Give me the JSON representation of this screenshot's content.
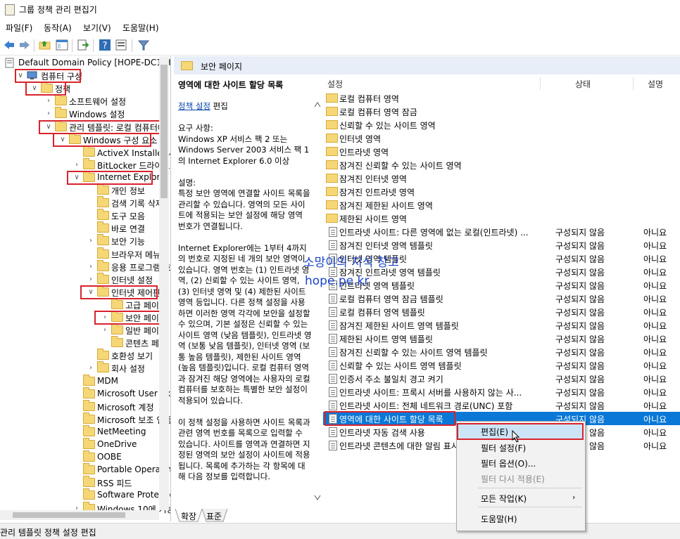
{
  "window": {
    "title": "그룹 정책 관리 편집기"
  },
  "menu": [
    "파일(F)",
    "동작(A)",
    "보기(V)",
    "도움말(H)"
  ],
  "tree": [
    {
      "label": "Default Domain Policy [HOPE-DC1.H",
      "indent": 0,
      "arrow": "",
      "icon": "policy"
    },
    {
      "label": "컴퓨터 구성",
      "indent": 1,
      "arrow": "v",
      "icon": "computer"
    },
    {
      "label": "정책",
      "indent": 2,
      "arrow": "v",
      "icon": "folder"
    },
    {
      "label": "소프트웨어 설정",
      "indent": 3,
      "arrow": ">",
      "icon": "folder"
    },
    {
      "label": "Windows 설정",
      "indent": 3,
      "arrow": ">",
      "icon": "folder"
    },
    {
      "label": "관리 템플릿: 로컬 컴퓨터에",
      "indent": 3,
      "arrow": "v",
      "icon": "folder"
    },
    {
      "label": "Windows 구성 요소",
      "indent": 4,
      "arrow": "v",
      "icon": "folder"
    },
    {
      "label": "ActiveX Installer 서비",
      "indent": 5,
      "arrow": "",
      "icon": "folder"
    },
    {
      "label": "BitLocker 드라이브",
      "indent": 5,
      "arrow": ">",
      "icon": "folder"
    },
    {
      "label": "Internet Explorer",
      "indent": 5,
      "arrow": "v",
      "icon": "folder"
    },
    {
      "label": "개인 정보",
      "indent": 6,
      "arrow": "",
      "icon": "folder"
    },
    {
      "label": "검색 기록 삭제",
      "indent": 6,
      "arrow": "",
      "icon": "folder"
    },
    {
      "label": "도구 모음",
      "indent": 6,
      "arrow": "",
      "icon": "folder"
    },
    {
      "label": "바로 연결",
      "indent": 6,
      "arrow": "",
      "icon": "folder"
    },
    {
      "label": "보안 기능",
      "indent": 6,
      "arrow": ">",
      "icon": "folder"
    },
    {
      "label": "브라우저 메뉴",
      "indent": 6,
      "arrow": "",
      "icon": "folder"
    },
    {
      "label": "응용 프로그램 호",
      "indent": 6,
      "arrow": ">",
      "icon": "folder"
    },
    {
      "label": "인터넷 설정",
      "indent": 6,
      "arrow": ">",
      "icon": "folder"
    },
    {
      "label": "인터넷 제어판",
      "indent": 6,
      "arrow": "v",
      "icon": "folder"
    },
    {
      "label": "고급 페이지",
      "indent": 7,
      "arrow": "",
      "icon": "folder"
    },
    {
      "label": "보안 페이지",
      "indent": 7,
      "arrow": ">",
      "icon": "folder"
    },
    {
      "label": "일반 페이지",
      "indent": 7,
      "arrow": ">",
      "icon": "folder"
    },
    {
      "label": "콘텐츠 페이",
      "indent": 7,
      "arrow": "",
      "icon": "folder"
    },
    {
      "label": "호환성 보기",
      "indent": 6,
      "arrow": "",
      "icon": "folder"
    },
    {
      "label": "회사 설정",
      "indent": 6,
      "arrow": ">",
      "icon": "folder"
    },
    {
      "label": "MDM",
      "indent": 5,
      "arrow": "",
      "icon": "folder"
    },
    {
      "label": "Microsoft User Expe",
      "indent": 5,
      "arrow": "",
      "icon": "folder"
    },
    {
      "label": "Microsoft 계정",
      "indent": 5,
      "arrow": "",
      "icon": "folder"
    },
    {
      "label": "Microsoft 보조 인증",
      "indent": 5,
      "arrow": "",
      "icon": "folder"
    },
    {
      "label": "NetMeeting",
      "indent": 5,
      "arrow": "",
      "icon": "folder"
    },
    {
      "label": "OneDrive",
      "indent": 5,
      "arrow": "",
      "icon": "folder"
    },
    {
      "label": "OOBE",
      "indent": 5,
      "arrow": "",
      "icon": "folder"
    },
    {
      "label": "Portable Operating",
      "indent": 5,
      "arrow": "",
      "icon": "folder"
    },
    {
      "label": "RSS 피드",
      "indent": 5,
      "arrow": "",
      "icon": "folder"
    },
    {
      "label": "Software Protection",
      "indent": 5,
      "arrow": "",
      "icon": "folder"
    },
    {
      "label": "Windows 10에 기능",
      "indent": 5,
      "arrow": ">",
      "icon": "folder"
    }
  ],
  "panel": {
    "title": "보안 페이지"
  },
  "description": {
    "title": "영역에 대한 사이트 할당 목록",
    "link": "정책 설정",
    "link_suffix": " 편집",
    "body": "요구 사항:\nWindows XP 서비스 팩 2 또는 Windows Server 2003 서비스 팩 1의 Internet Explorer 6.0 이상\n\n설명:\n특정 보안 영역에 연결할 사이트 목록을 관리할 수 있습니다. 영역의 모든 사이트에 적용되는 보안 설정에 해당 영역 번호가 연결됩니다.\n\nInternet Explorer에는 1부터 4까지의 번호로 지정된 네 개의 보안 영역이 있습니다. 영역 번호는 (1) 인트라넷 영역, (2) 신뢰할 수 있는 사이트 영역, (3) 인터넷 영역 및 (4) 제한된 사이트 영역 등입니다. 다른 정책 설정을 사용하면 이러한 영역 각각에 보안을 설정할 수 있으며, 기본 설정은 신뢰할 수 있는 사이트 영역 (낮음 템플릿), 인트라넷 영역 (보통 낮음 템플릿), 인터넷 영역 (보통 높음 템플릿), 제한된 사이트 영역 (높음 템플릿)입니다. 로컬 컴퓨터 영역과 잠겨진 해당 영역에는 사용자의 로컬 컴퓨터를 보호하는 특별한 보안 설정이 적용되어 있습니다.\n\n이 정책 설정을 사용하면 사이트 목록과 관련 영역 번호를 목록으로 입력할 수 있습니다. 사이트를 영역과 연결하면 지정된 영역의 보안 설정이 사이트에 적용됩니다. 목록에 추가하는 각 항목에 대해 다음 정보를 입력합니다."
  },
  "columns": {
    "setting": "설정",
    "state": "상태",
    "comment": "설명"
  },
  "rows": [
    {
      "name": "로컬 컴퓨터 영역",
      "state": "",
      "comment": "",
      "type": "folder"
    },
    {
      "name": "로컬 컴퓨터 영역 잠금",
      "state": "",
      "comment": "",
      "type": "folder"
    },
    {
      "name": "신뢰할 수 있는 사이트 영역",
      "state": "",
      "comment": "",
      "type": "folder"
    },
    {
      "name": "인터넷 영역",
      "state": "",
      "comment": "",
      "type": "folder"
    },
    {
      "name": "인트라넷 영역",
      "state": "",
      "comment": "",
      "type": "folder"
    },
    {
      "name": "잠겨진 신뢰할 수 있는 사이트 영역",
      "state": "",
      "comment": "",
      "type": "folder"
    },
    {
      "name": "잠겨진 인터넷 영역",
      "state": "",
      "comment": "",
      "type": "folder"
    },
    {
      "name": "잠겨진 인트라넷 영역",
      "state": "",
      "comment": "",
      "type": "folder"
    },
    {
      "name": "잠겨진 제한된 사이트 영역",
      "state": "",
      "comment": "",
      "type": "folder"
    },
    {
      "name": "제한된 사이트 영역",
      "state": "",
      "comment": "",
      "type": "folder"
    },
    {
      "name": "인트라넷 사이트: 다른 영역에 없는 로컬(인트라넷) ...",
      "state": "구성되지 않음",
      "comment": "아니요",
      "type": "policy"
    },
    {
      "name": "잠겨진 인터넷 영역 템플릿",
      "state": "구성되지 않음",
      "comment": "아니요",
      "type": "policy"
    },
    {
      "name": "인터넷 영역 템플릿",
      "state": "구성되지 않음",
      "comment": "아니요",
      "type": "policy"
    },
    {
      "name": "잠겨진 인트라넷 영역 템플릿",
      "state": "구성되지 않음",
      "comment": "아니요",
      "type": "policy"
    },
    {
      "name": "인트라넷 영역 템플릿",
      "state": "구성되지 않음",
      "comment": "아니요",
      "type": "policy"
    },
    {
      "name": "로컬 컴퓨터 영역 잠금 템플릿",
      "state": "구성되지 않음",
      "comment": "아니요",
      "type": "policy"
    },
    {
      "name": "로컬 컴퓨터 영역 템플릿",
      "state": "구성되지 않음",
      "comment": "아니요",
      "type": "policy"
    },
    {
      "name": "잠겨진 제한된 사이트 영역 템플릿",
      "state": "구성되지 않음",
      "comment": "아니요",
      "type": "policy"
    },
    {
      "name": "제한된 사이트 영역 템플릿",
      "state": "구성되지 않음",
      "comment": "아니요",
      "type": "policy"
    },
    {
      "name": "잠겨진 신뢰할 수 있는 사이트 영역 템플릿",
      "state": "구성되지 않음",
      "comment": "아니요",
      "type": "policy"
    },
    {
      "name": "신뢰할 수 있는 사이트 영역 템플릿",
      "state": "구성되지 않음",
      "comment": "아니요",
      "type": "policy"
    },
    {
      "name": "인증서 주소 불일치 경고 켜기",
      "state": "구성되지 않음",
      "comment": "아니요",
      "type": "policy"
    },
    {
      "name": "인트라넷 사이트: 프록시 서버를 사용하지 않는 사...",
      "state": "구성되지 않음",
      "comment": "아니요",
      "type": "policy"
    },
    {
      "name": "인트라넷 사이트: 전체 네트워크 경로(UNC) 포함",
      "state": "구성되지 않음",
      "comment": "아니요",
      "type": "policy"
    },
    {
      "name": "영역에 대한 사이트 할당 목록",
      "state": "구성되지 않음",
      "comment": "아니요",
      "type": "policy",
      "selected": true
    },
    {
      "name": "인트라넷 자동 검색 사용",
      "state": "구성되지 않음",
      "comment": "아니요",
      "type": "policy"
    },
    {
      "name": "인트라넷 콘텐츠에 대한 알림 표시줄",
      "state": "구성되지 않음",
      "comment": "아니요",
      "type": "policy"
    }
  ],
  "tabs": [
    "확장",
    "표준"
  ],
  "status": "관리 템플릿 정책 설정 편집",
  "context_menu": {
    "edit": "편집(E)",
    "filter_on": "필터 설정(F)",
    "filter_options": "필터 옵션(O)...",
    "reapply": "필터 다시 적용(E)",
    "all_tasks": "모든 작업(K)",
    "help": "도움말(H)"
  },
  "watermark": {
    "line1": "소망이의 지식 창고",
    "line2": "hope.pe.kr"
  },
  "colors": {
    "highlight": "#d9232d",
    "selection": "#0a78d7",
    "watermark": "#1a44cc"
  }
}
